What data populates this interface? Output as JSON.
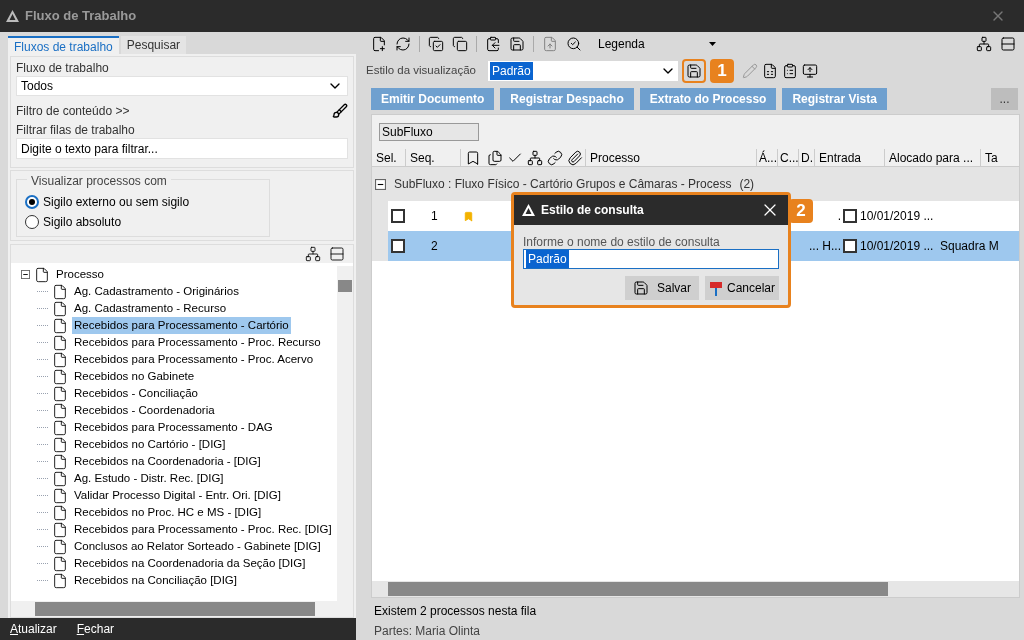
{
  "window": {
    "title": "Fluxo de Trabalho"
  },
  "left_tabs": [
    {
      "label": "Fluxos de trabalho",
      "selected": true
    },
    {
      "label": "Pesquisar",
      "selected": false
    }
  ],
  "workflow": {
    "label": "Fluxo de trabalho",
    "value": "Todos"
  },
  "content_filter": {
    "label": "Filtro de conteúdo >>"
  },
  "queue_filter": {
    "label": "Filtrar filas de trabalho",
    "placeholder": "Digite o texto para filtrar..."
  },
  "visibility": {
    "legend": "Visualizar processos com",
    "options": [
      {
        "label": "Sigilo externo ou sem sigilo",
        "selected": true
      },
      {
        "label": "Sigilo absoluto",
        "selected": false
      }
    ]
  },
  "tree": [
    {
      "label": "Processo",
      "expanded": true,
      "selected": false,
      "children": [
        {
          "label": "Ag. Cadastramento - Originários",
          "selected": false
        },
        {
          "label": "Ag. Cadastramento - Recurso",
          "selected": false
        },
        {
          "label": "Recebidos para Processamento - Cartório",
          "selected": true
        },
        {
          "label": "Recebidos para Processamento - Proc. Recurso",
          "selected": false
        },
        {
          "label": "Recebidos para Processamento - Proc. Acervo",
          "selected": false
        },
        {
          "label": "Recebidos no Gabinete",
          "selected": false
        },
        {
          "label": "Recebidos - Conciliação",
          "selected": false
        },
        {
          "label": "Recebidos - Coordenadoria",
          "selected": false
        },
        {
          "label": "Recebidos para Processamento - DAG",
          "selected": false
        },
        {
          "label": "Recebidos no Cartório - [DIG]",
          "selected": false
        },
        {
          "label": "Recebidos na Coordenadoria - [DIG]",
          "selected": false
        },
        {
          "label": "Ag. Estudo - Distr. Rec. [DIG]",
          "selected": false
        },
        {
          "label": "Validar Processo Digital - Entr. Ori. [DIG]",
          "selected": false
        },
        {
          "label": "Recebidos no Proc. HC e MS - [DIG]",
          "selected": false
        },
        {
          "label": "Recebidos para Processamento - Proc. Rec. [DIG]",
          "selected": false
        },
        {
          "label": "Conclusos ao Relator Sorteado - Gabinete [DIG]",
          "selected": false
        },
        {
          "label": "Recebidos na Coordenadoria da Seção [DIG]",
          "selected": false
        },
        {
          "label": "Recebidos na Conciliação [DIG]",
          "selected": false
        }
      ]
    }
  ],
  "bottom_actions": [
    "Atualizar",
    "Fechar"
  ],
  "toolbar": {
    "legend_label": "Legenda"
  },
  "view_style": {
    "label": "Estilo da visualização",
    "value": "Padrão"
  },
  "action_buttons": [
    "Emitir Documento",
    "Registrar Despacho",
    "Extrato do Processo",
    "Registrar Vista"
  ],
  "more_button": "...",
  "group_chip": "SubFluxo",
  "columns": [
    "Sel.",
    "Seq.",
    "Processo",
    "Á...",
    "C...",
    "D.",
    "Entrada",
    "Alocado para ...",
    "Ta"
  ],
  "group_row": {
    "label": "SubFluxo : Fluxo Físico - Cartório Grupos e Câmaras - Process",
    "count": "(2)",
    "expanded": true
  },
  "rows": [
    {
      "seq": "1",
      "checked": false,
      "bookmarked": true,
      "selected": false,
      "hidden_part": ".",
      "flag_checked": false,
      "entrada": "10/01/2019 ...",
      "alocado": ""
    },
    {
      "seq": "2",
      "checked": false,
      "bookmarked": false,
      "selected": true,
      "hidden_part": "... H...",
      "flag_checked": false,
      "entrada": "10/01/2019 ...",
      "alocado": "Squadra M"
    }
  ],
  "status": "Existem 2 processos nesta fila",
  "parties": "Partes: Maria Olinta",
  "dialog": {
    "title": "Estilo de consulta",
    "prompt": "Informe o nome do estilo de consulta",
    "value": "Padrão",
    "buttons": [
      "Salvar",
      "Cancelar"
    ]
  },
  "callouts": [
    "1",
    "2"
  ]
}
